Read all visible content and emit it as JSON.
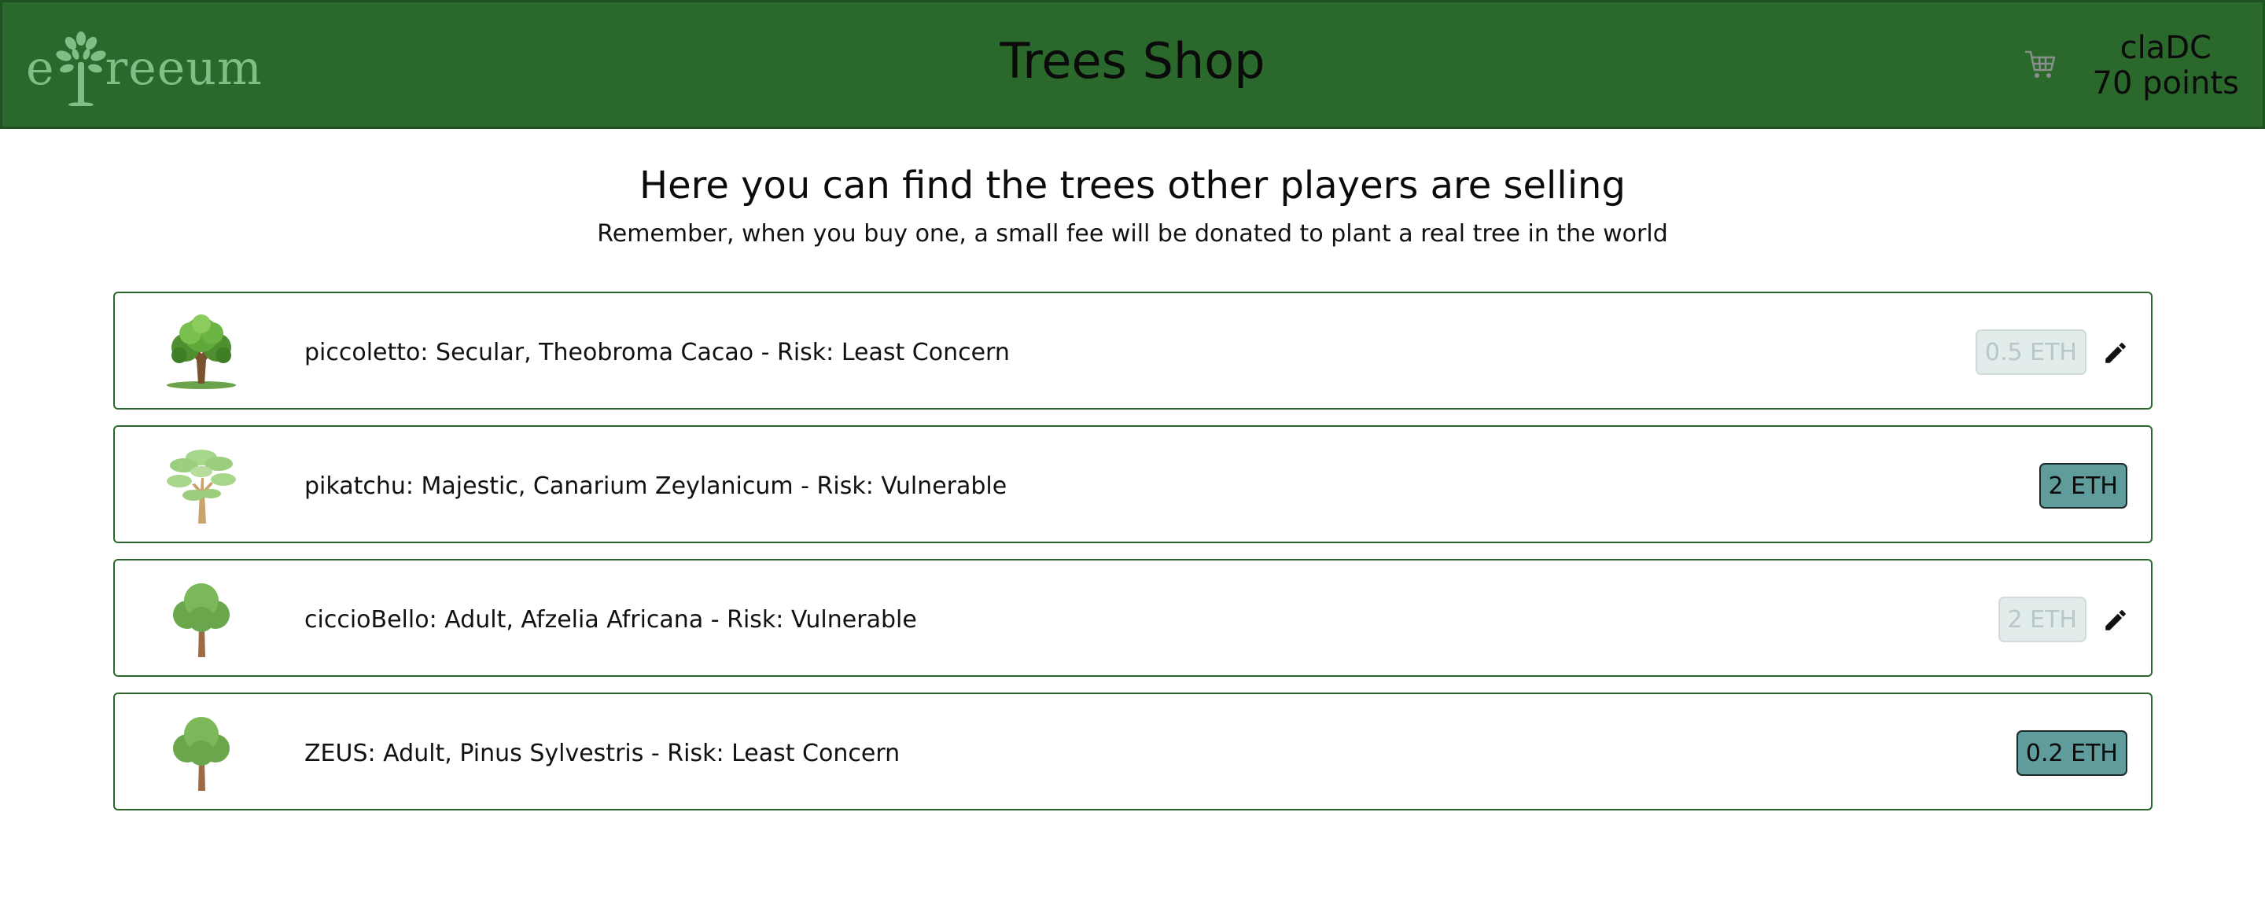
{
  "header": {
    "logo_text_left": "e",
    "logo_text_right": "reeum",
    "title": "Trees Shop",
    "cart_icon": "cart-icon",
    "user_name": "claDC",
    "user_points": "70 points"
  },
  "intro": {
    "heading": "Here you can find the trees other players are selling",
    "subheading": "Remember, when you buy one, a small fee will be donated to plant a real tree in the world"
  },
  "listings": [
    {
      "text": "piccoletto: Secular, Theobroma Cacao - Risk: Least Concern",
      "price": "0.5 ETH",
      "owned": true,
      "icon": "oak-tree-icon"
    },
    {
      "text": "pikatchu: Majestic, Canarium Zeylanicum - Risk: Vulnerable",
      "price": "2 ETH",
      "owned": false,
      "icon": "tall-tree-icon"
    },
    {
      "text": "ciccioBello: Adult, Afzelia Africana - Risk: Vulnerable",
      "price": "2 ETH",
      "owned": true,
      "icon": "round-tree-icon"
    },
    {
      "text": "ZEUS: Adult, Pinus Sylvestris - Risk: Least Concern",
      "price": "0.2 ETH",
      "owned": false,
      "icon": "round-tree-icon"
    }
  ],
  "colors": {
    "header_bg": "#2a682c",
    "buy_button": "#5f9c9b",
    "disabled_button": "#e2eceb",
    "card_border": "#2a682c"
  }
}
